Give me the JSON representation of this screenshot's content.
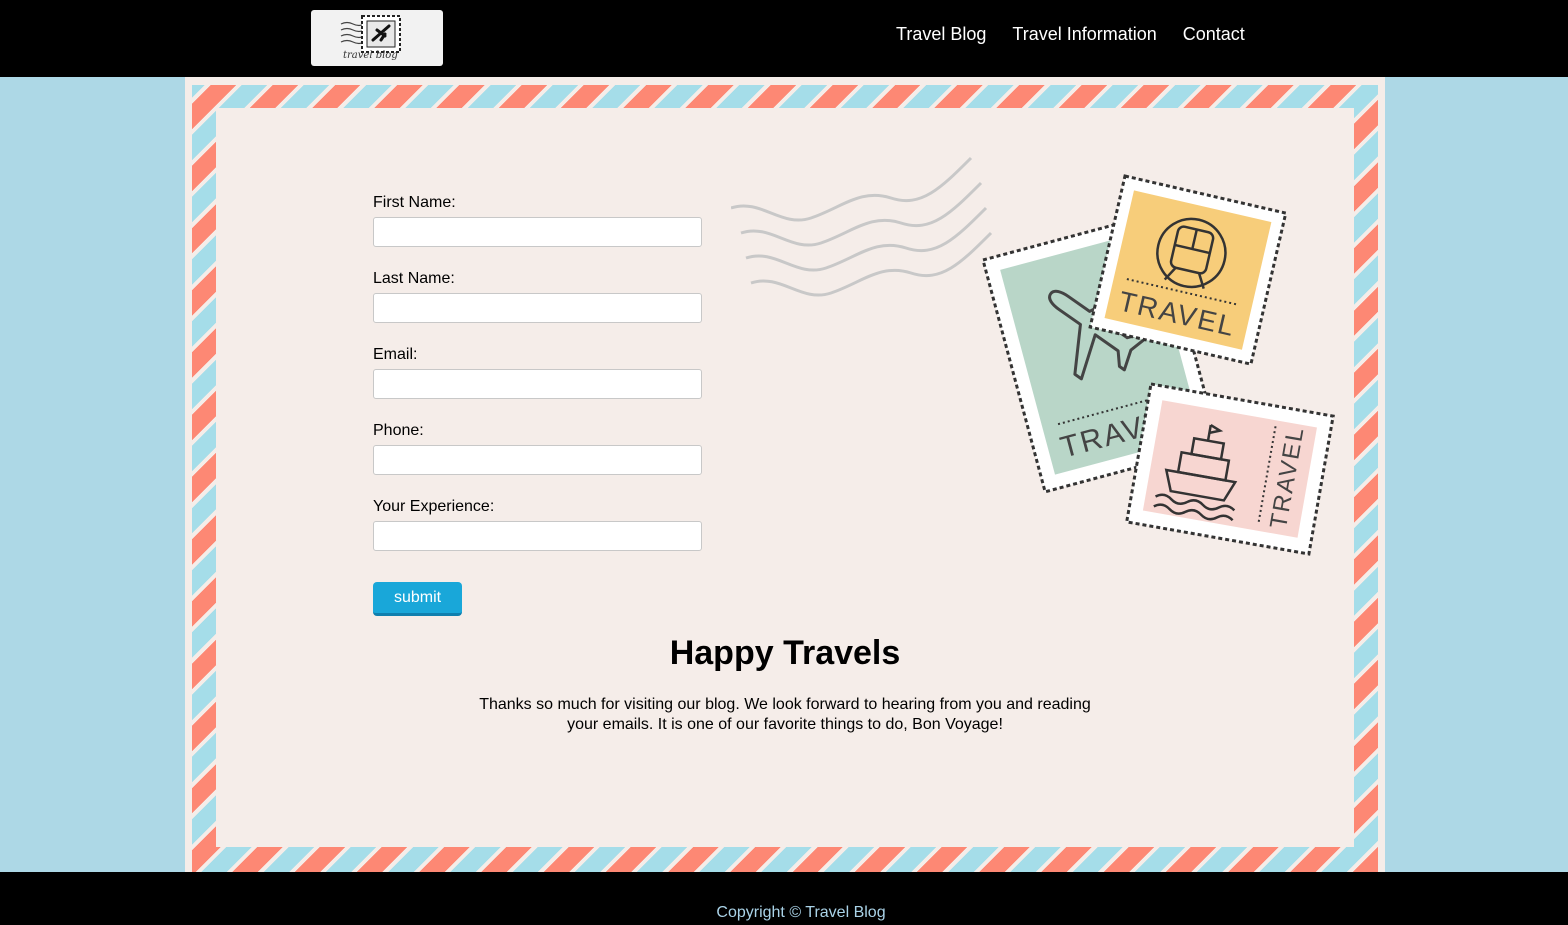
{
  "header": {
    "logo": {
      "text": "travel blog"
    },
    "nav": [
      {
        "label": "Travel Blog"
      },
      {
        "label": "Travel Information"
      },
      {
        "label": "Contact"
      }
    ]
  },
  "form": {
    "fields": [
      {
        "label": "First Name:",
        "value": ""
      },
      {
        "label": "Last Name:",
        "value": ""
      },
      {
        "label": "Email:",
        "value": ""
      },
      {
        "label": "Phone:",
        "value": ""
      },
      {
        "label": "Your Experience:",
        "value": ""
      }
    ],
    "submit_label": "submit"
  },
  "stamps": [
    {
      "text": "TRAVEL",
      "icon": "airplane-icon",
      "color": "#b9d6c8"
    },
    {
      "text": "TRAVEL",
      "icon": "train-icon",
      "color": "#f7cd7a"
    },
    {
      "text": "TRAVEL",
      "icon": "ship-icon",
      "color": "#f7d6d1"
    }
  ],
  "main": {
    "heading": "Happy Travels",
    "message": "Thanks so much for visiting our blog. We look forward to hearing from you and reading your emails. It is one of our favorite things to do, Bon Voyage!"
  },
  "footer": {
    "copyright": "Copyright © Travel Blog"
  },
  "colors": {
    "header_bg": "#000000",
    "page_bg": "#add8e6",
    "paper": "#f5ede9",
    "stripe_red": "#fd8874",
    "stripe_blue": "#a5dde9",
    "button": "#19a7d9"
  }
}
